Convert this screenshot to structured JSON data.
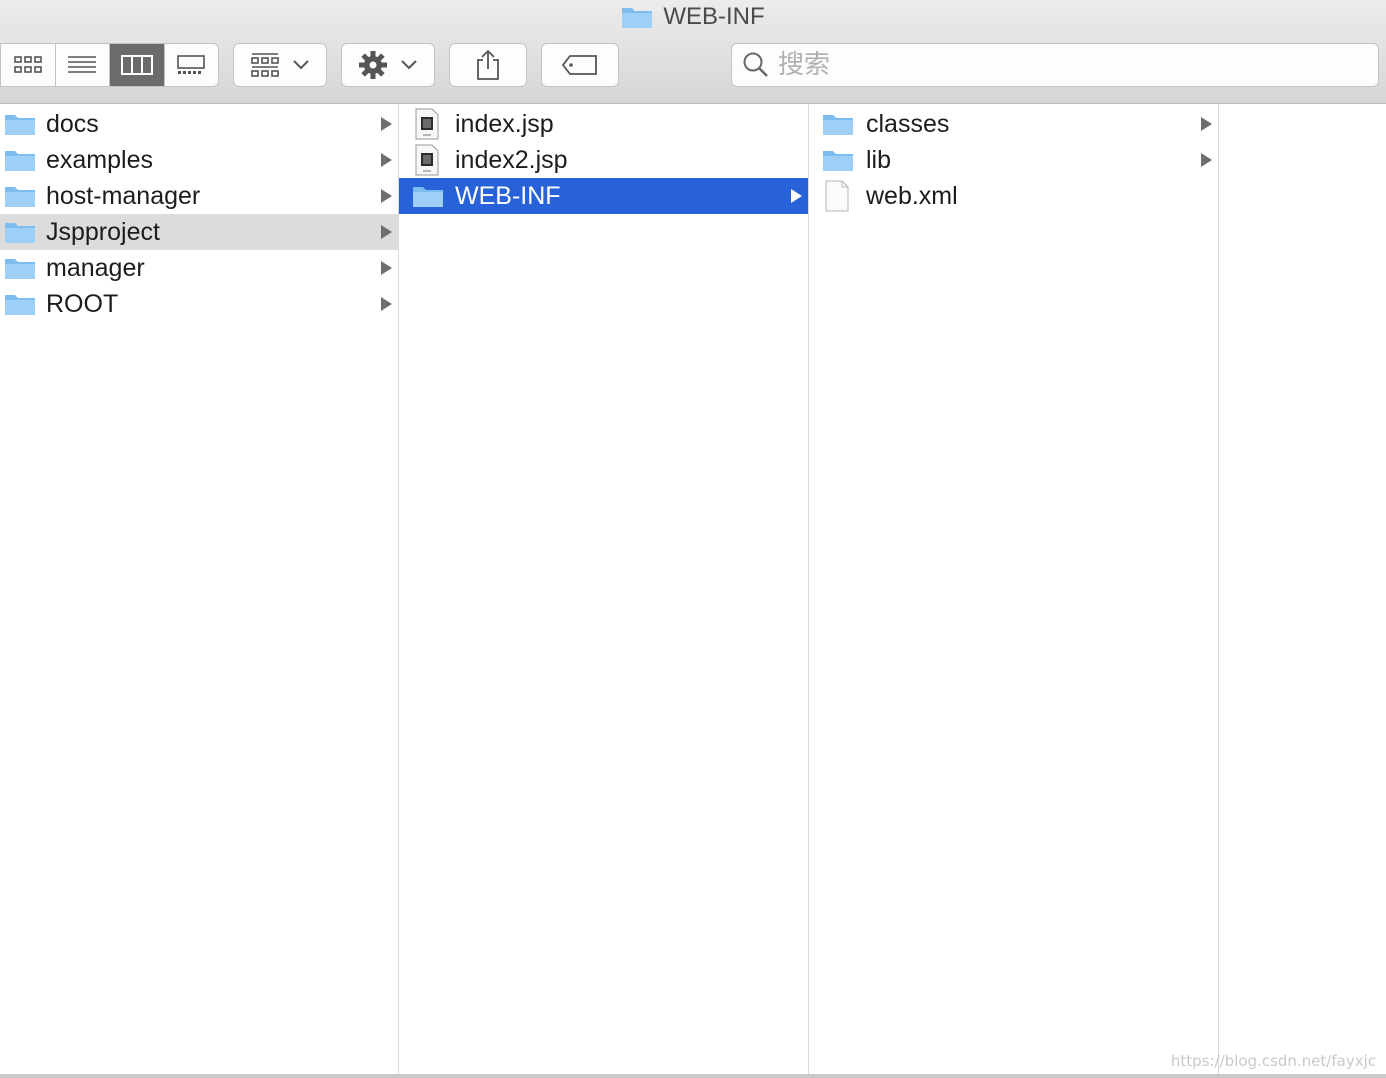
{
  "window": {
    "title": "WEB-INF",
    "title_icon": "folder-icon"
  },
  "toolbar": {
    "view_modes": [
      {
        "name": "icon-view",
        "icon": "grid-icon",
        "active": false
      },
      {
        "name": "list-view",
        "icon": "list-icon",
        "active": false
      },
      {
        "name": "column-view",
        "icon": "columns-icon",
        "active": true
      },
      {
        "name": "gallery-view",
        "icon": "gallery-icon",
        "active": false
      }
    ],
    "group_button": {
      "icon": "group-grid-icon",
      "chevron": "chevron-down-icon"
    },
    "action_button": {
      "icon": "gear-icon",
      "chevron": "chevron-down-icon"
    },
    "share_button": {
      "icon": "share-icon"
    },
    "tag_button": {
      "icon": "tag-icon"
    },
    "search": {
      "placeholder": "搜索",
      "value": "",
      "icon": "search-icon"
    }
  },
  "columns": [
    {
      "items": [
        {
          "name": "docs",
          "type": "folder",
          "has_children": true,
          "state": "normal"
        },
        {
          "name": "examples",
          "type": "folder",
          "has_children": true,
          "state": "normal"
        },
        {
          "name": "host-manager",
          "type": "folder",
          "has_children": true,
          "state": "normal"
        },
        {
          "name": "Jspproject",
          "type": "folder",
          "has_children": true,
          "state": "highlighted"
        },
        {
          "name": "manager",
          "type": "folder",
          "has_children": true,
          "state": "normal"
        },
        {
          "name": "ROOT",
          "type": "folder",
          "has_children": true,
          "state": "normal"
        }
      ]
    },
    {
      "items": [
        {
          "name": "index.jsp",
          "type": "jsp-file",
          "has_children": false,
          "state": "normal"
        },
        {
          "name": "index2.jsp",
          "type": "jsp-file",
          "has_children": false,
          "state": "normal"
        },
        {
          "name": "WEB-INF",
          "type": "folder",
          "has_children": true,
          "state": "selected"
        }
      ]
    },
    {
      "items": [
        {
          "name": "classes",
          "type": "folder",
          "has_children": true,
          "state": "normal"
        },
        {
          "name": "lib",
          "type": "folder",
          "has_children": true,
          "state": "normal"
        },
        {
          "name": "web.xml",
          "type": "file",
          "has_children": false,
          "state": "normal"
        }
      ]
    },
    {
      "items": []
    }
  ],
  "watermark": "https://blog.csdn.net/fayxjc",
  "colors": {
    "selection": "#2862d9",
    "highlight": "#dcdcdc",
    "folder": "#7fbff0"
  }
}
